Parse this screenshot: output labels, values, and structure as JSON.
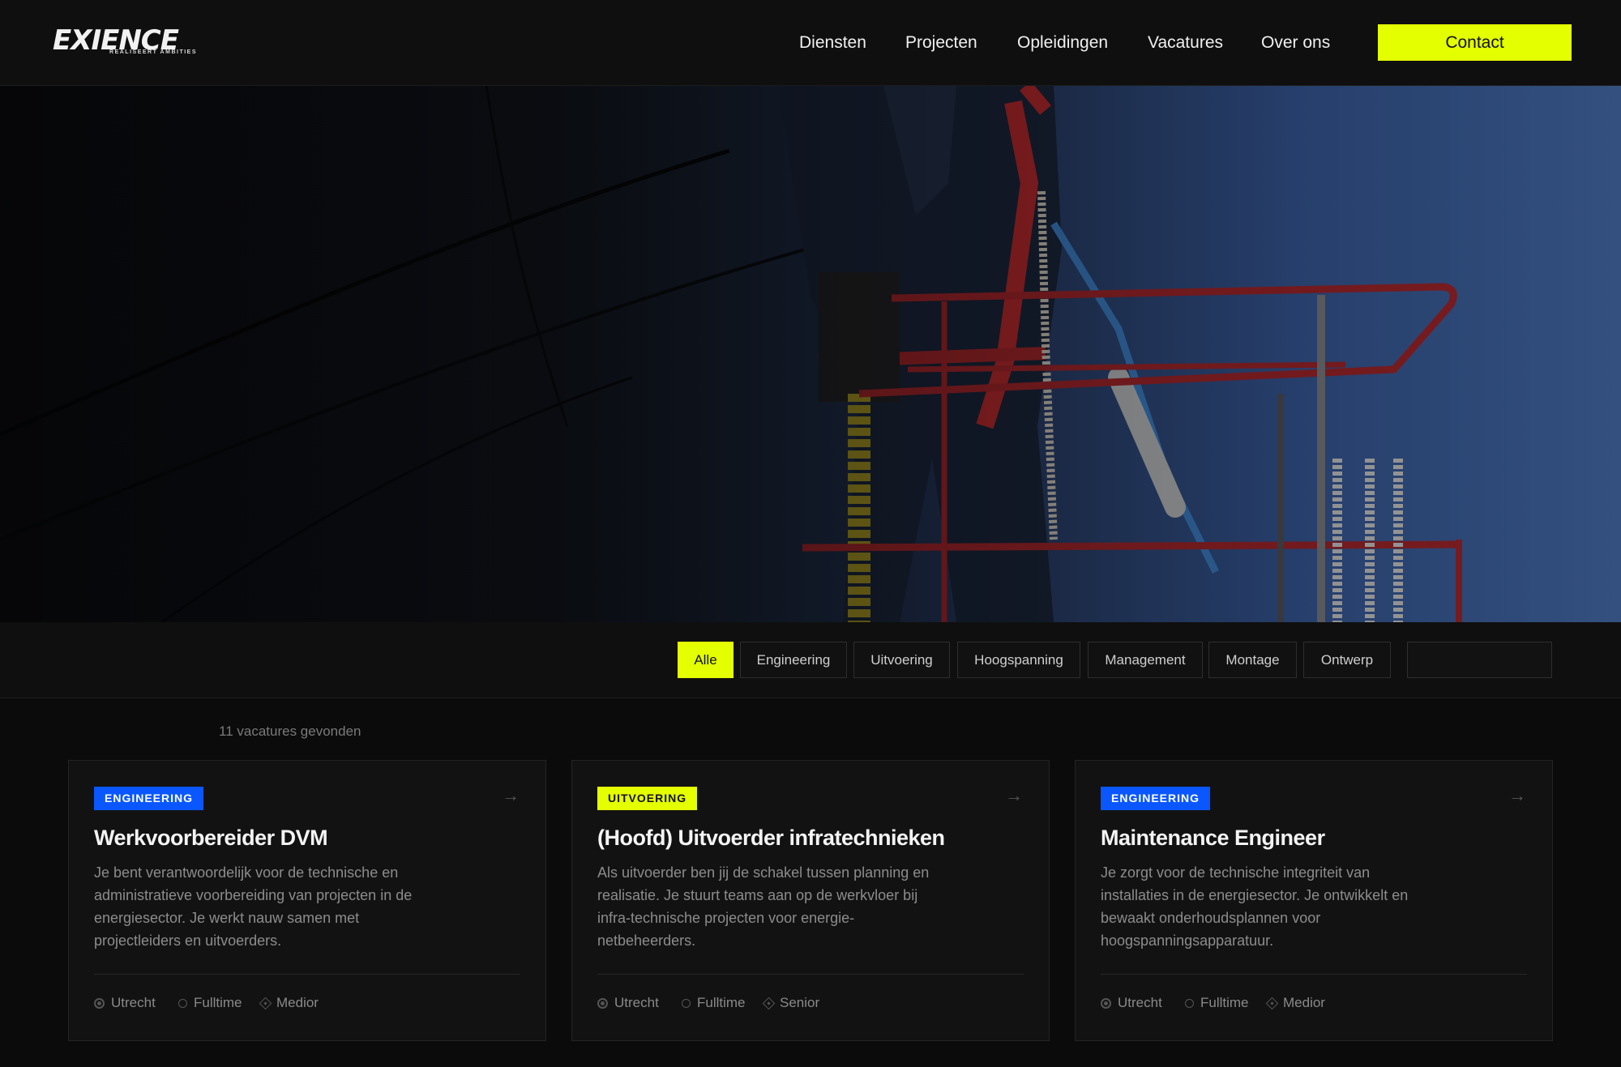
{
  "header": {
    "logo": {
      "main": "EXIENCE",
      "tagline": "REALISEERT AMBITIES"
    },
    "nav": [
      {
        "label": "Diensten"
      },
      {
        "label": "Projecten"
      },
      {
        "label": "Opleidingen"
      },
      {
        "label": "Vacatures"
      },
      {
        "label": "Over ons"
      }
    ],
    "contact_label": "Contact",
    "accent_color": "#e4ff00"
  },
  "hero": {
    "image": "worker-on-aerial-lift-photo"
  },
  "filters": {
    "chips": [
      {
        "label": "Alle",
        "active": true
      },
      {
        "label": "Engineering",
        "active": false
      },
      {
        "label": "Uitvoering",
        "active": false
      },
      {
        "label": "Hoogspanning",
        "active": false
      },
      {
        "label": "Management",
        "active": false
      },
      {
        "label": "Montage",
        "active": false
      },
      {
        "label": "Ontwerp",
        "active": false
      }
    ],
    "search": {
      "value": "",
      "placeholder": ""
    }
  },
  "results": {
    "count_text": "11 vacatures gevonden"
  },
  "jobs": [
    {
      "category": "ENGINEERING",
      "category_color": "#0a57ff",
      "title": "Werkvoorbereider DVM",
      "description": "Je bent verantwoordelijk voor de technische en administratieve voorbereiding van projecten in de energiesector. Je werkt nauw samen met projectleiders en uitvoerders.",
      "location": "Utrecht",
      "hours": "Fulltime",
      "level": "Medior",
      "icons": {
        "location": "location-icon",
        "hours": "clock-icon",
        "level": "level-icon",
        "arrow": "arrow-right-icon"
      }
    },
    {
      "category": "UITVOERING",
      "category_color": "#e4ff00",
      "title": "(Hoofd) Uitvoerder infratechnieken",
      "description": "Als uitvoerder ben jij de schakel tussen planning en realisatie. Je stuurt teams aan op de werkvloer bij infra-technische projecten voor energie-netbeheerders.",
      "location": "Utrecht",
      "hours": "Fulltime",
      "level": "Senior",
      "icons": {
        "location": "location-icon",
        "hours": "clock-icon",
        "level": "level-icon",
        "arrow": "arrow-right-icon"
      }
    },
    {
      "category": "ENGINEERING",
      "category_color": "#0a57ff",
      "title": "Maintenance Engineer",
      "description": "Je zorgt voor de technische integriteit van installaties in de energiesector. Je ontwikkelt en bewaakt onderhoudsplannen voor hoogspanningsapparatuur.",
      "location": "Utrecht",
      "hours": "Fulltime",
      "level": "Medior",
      "icons": {
        "location": "location-icon",
        "hours": "clock-icon",
        "level": "level-icon",
        "arrow": "arrow-right-icon"
      }
    }
  ]
}
